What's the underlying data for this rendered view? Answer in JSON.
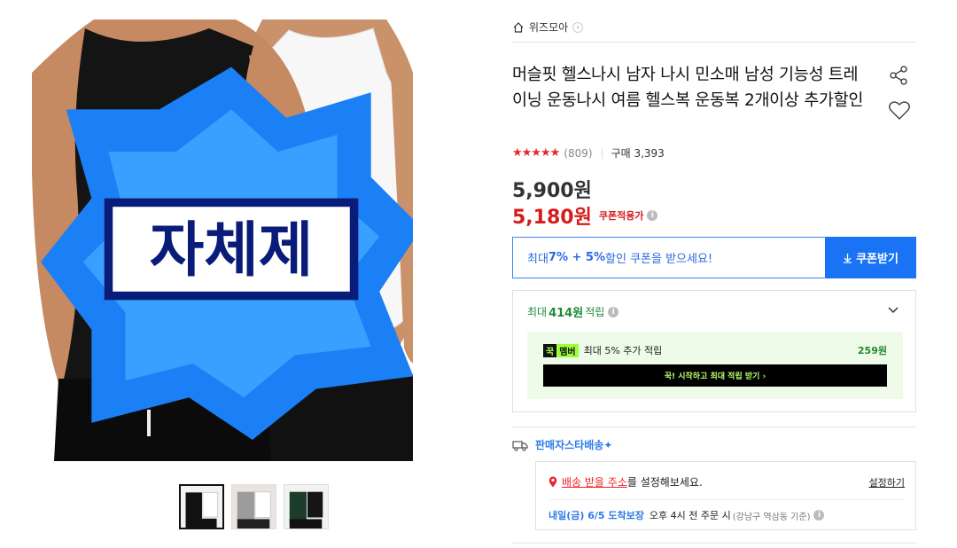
{
  "product": {
    "badge_text": "자체제작",
    "thumbnails": [
      "black-white-tank",
      "gray-white-tank",
      "green-black-tank"
    ]
  },
  "breadcrumb": {
    "store": "위즈모아"
  },
  "title": "머슬핏 헬스나시 남자 나시 민소매 남성 기능성 트레이닝 운동나시 여름 헬스복 운동복 2개이상 추가할인",
  "rating": {
    "stars": "★★★★★",
    "value": 4.5,
    "review_count": "(809)",
    "purchase_label": "구매 3,393"
  },
  "price": {
    "original": "5,900원",
    "sale": "5,180원",
    "coupon_note": "쿠폰적용가"
  },
  "coupon": {
    "text_prefix": "최대 ",
    "text_highlight": "7% + 5%",
    "text_suffix": " 할인 쿠폰을 받으세요!",
    "button_label": "쿠폰받기"
  },
  "points": {
    "prefix": "최대",
    "amount": "414원",
    "suffix": "적립",
    "member_logo_1": "꾹",
    "member_logo_2": "멤버",
    "member_text": "최대 5% 추가 적립",
    "member_amount": "259원",
    "member_button": "꾹! 시작하고 최대 적립 받기 ›"
  },
  "shipping": {
    "header": "판매자스타배송✦",
    "address_link": "배송 받을 주소",
    "address_suffix": "를 설정해보세요.",
    "set_link": "설정하기",
    "eta_strong": "내일(금) 6/5 도착보장",
    "eta_text": "오후 4시 전 주문 시",
    "eta_small": "(강남구 역삼동 기준)"
  },
  "colors": {
    "accent_blue": "#1a73f5",
    "sale_red": "#d71b1b",
    "green": "#1e8a35",
    "star_red": "#e8262b"
  }
}
